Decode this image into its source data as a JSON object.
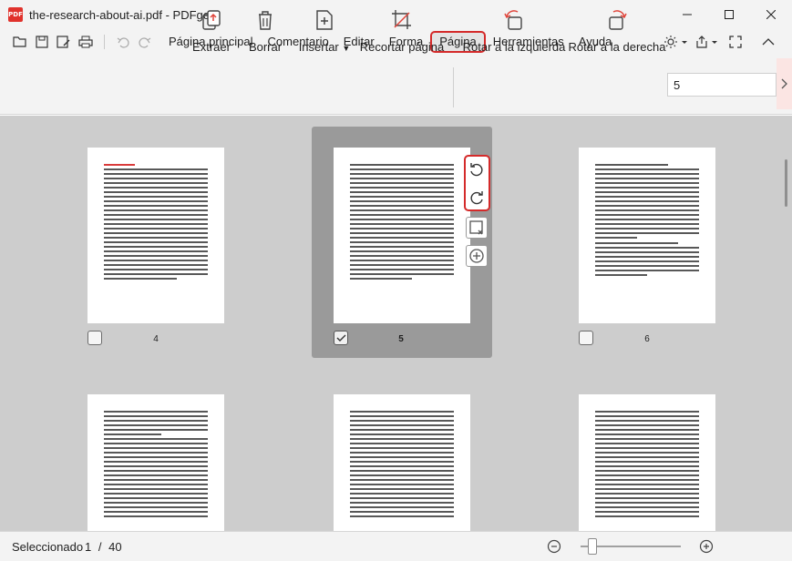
{
  "window": {
    "logo_text": "PDF",
    "title": "the-research-about-ai.pdf - PDFgear"
  },
  "menu": {
    "items": [
      "Página principal",
      "Comentario",
      "Editar",
      "Forma",
      "Página",
      "Herramientas",
      "Ayuda"
    ],
    "active": "Página"
  },
  "toolbar": {
    "tools": [
      {
        "label": "Extraer",
        "icon": "extract-icon"
      },
      {
        "label": "Borrar",
        "icon": "trash-icon"
      },
      {
        "label": "Insertar",
        "icon": "insert-page-icon",
        "has_dropdown": true
      },
      {
        "label": "Recortar página",
        "icon": "crop-icon"
      },
      {
        "label": "Rotar a la izquierda",
        "icon": "rotate-left-icon"
      },
      {
        "label": "Rotar a la derecha",
        "icon": "rotate-right-icon"
      }
    ],
    "page_input_value": "5"
  },
  "pages": [
    {
      "number": "4",
      "checked": false,
      "selected": false
    },
    {
      "number": "5",
      "checked": true,
      "selected": true
    },
    {
      "number": "6",
      "checked": false,
      "selected": false
    }
  ],
  "status": {
    "selected_label": "Seleccionado",
    "current_page": "1",
    "separator": "/",
    "total_pages": "40"
  },
  "colors": {
    "accent_red": "#d42a2a",
    "background_gray": "#cdcdcd",
    "chrome": "#f3f3f3"
  }
}
